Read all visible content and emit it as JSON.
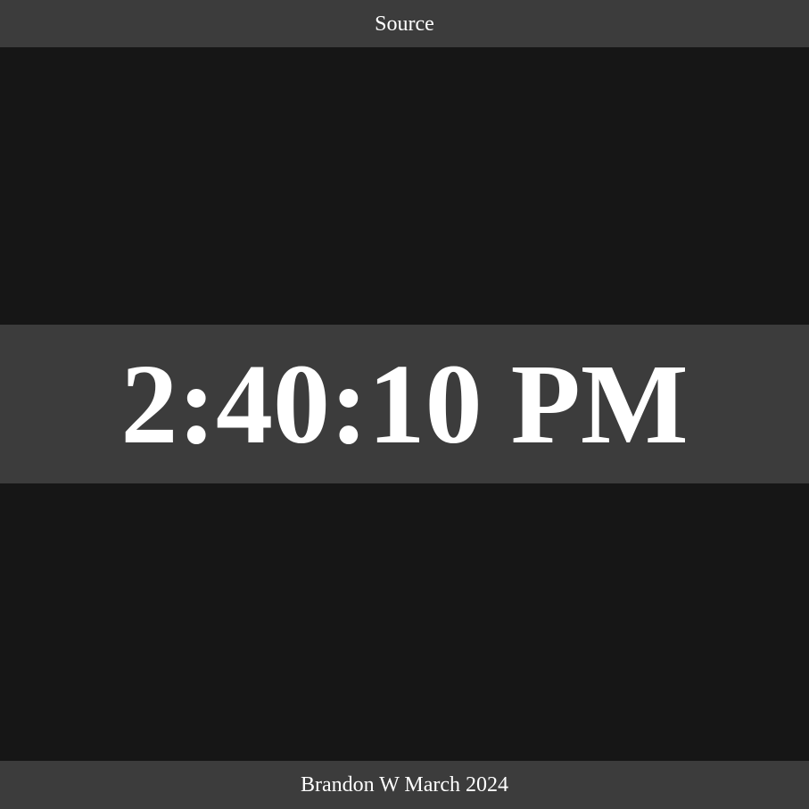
{
  "header": {
    "source_link_label": "Source"
  },
  "clock": {
    "time_text": "2:40:10 PM"
  },
  "footer": {
    "credit_text": "Brandon W March 2024"
  },
  "colors": {
    "background": "#161616",
    "bar": "#3c3c3c",
    "text": "#ffffff"
  }
}
